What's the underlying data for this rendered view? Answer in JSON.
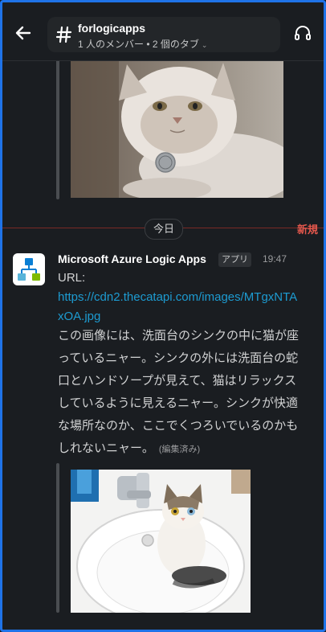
{
  "header": {
    "channel_name": "forlogicapps",
    "channel_subtitle": "1 人のメンバー • 2 個のタブ",
    "back_icon": "arrow-left-icon",
    "channel_icon": "hash-icon",
    "call_icon": "headphones-icon",
    "subtitle_icon": "chevron-down-icon"
  },
  "divider": {
    "today_label": "今日",
    "new_label": "新規",
    "new_color": "#e2574c"
  },
  "message": {
    "sender": "Microsoft Azure Logic Apps",
    "app_badge": "アプリ",
    "time": "19:47",
    "url_label": "URL:",
    "url_line1": "https://cdn2.thecatapi.com/images/MTgxNTA",
    "url_line2": "xOA.jpg",
    "body_lines": [
      "この画像には、洗面台のシンクの中に猫が座",
      "っているニャー。シンクの外には洗面台の蛇",
      "口とハンドソープが見えて、猫はリラックス",
      "しているように見えるニャー。シンクが快適",
      "な場所なのか、ここでくつろいでいるのかも",
      "しれないニャー。"
    ],
    "edited_label": "(編集済み)",
    "avatar_icon": "logic-apps-icon"
  },
  "images": {
    "top": "persian-cat-photo",
    "bottom": "cat-in-sink-photo"
  },
  "colors": {
    "background": "#1a1d21",
    "link": "#1d9bd1",
    "frame": "#1f73e8"
  }
}
